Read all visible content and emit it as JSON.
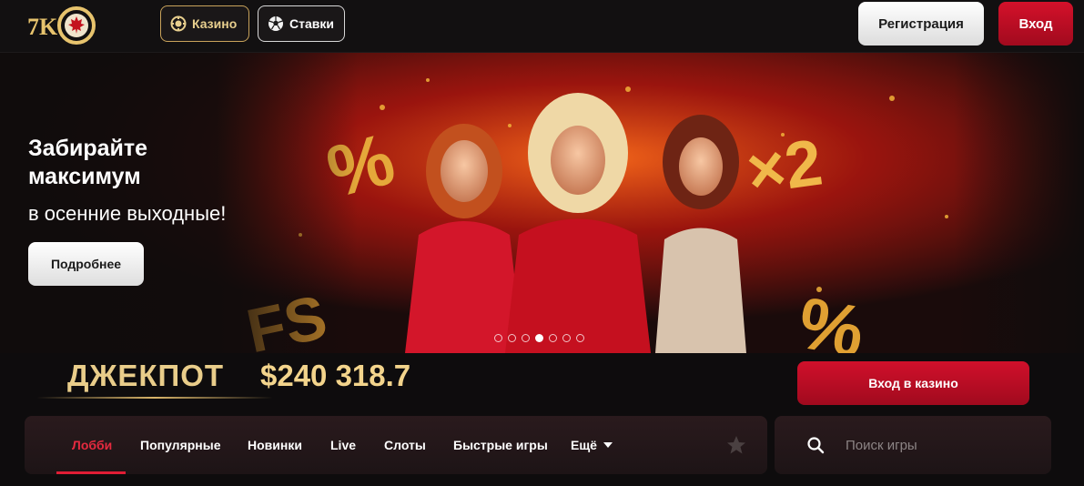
{
  "header": {
    "logo_text": "7K",
    "nav": [
      {
        "label": "Казино",
        "icon": "casino-chip-icon"
      },
      {
        "label": "Ставки",
        "icon": "soccer-ball-icon"
      }
    ],
    "register_label": "Регистрация",
    "login_label": "Вход"
  },
  "banner": {
    "title": "Забирайте максимум",
    "subtitle": "в осенние выходные!",
    "more_label": "Подробнее",
    "slide_count": 7,
    "active_slide": 4
  },
  "jackpot": {
    "label": "ДЖЕКПОТ",
    "value": "$240 318.7",
    "enter_label": "Вход в казино"
  },
  "categories": {
    "items": [
      {
        "label": "Лобби",
        "active": true
      },
      {
        "label": "Популярные",
        "active": false
      },
      {
        "label": "Новинки",
        "active": false
      },
      {
        "label": "Live",
        "active": false
      },
      {
        "label": "Слоты",
        "active": false
      },
      {
        "label": "Быстрые игры",
        "active": false
      },
      {
        "label": "Ещё",
        "active": false
      }
    ]
  },
  "search": {
    "placeholder": "Поиск игры"
  },
  "colors": {
    "accent_red": "#d1102b",
    "gold": "#e9cd8a",
    "background": "#0e0c0d"
  }
}
